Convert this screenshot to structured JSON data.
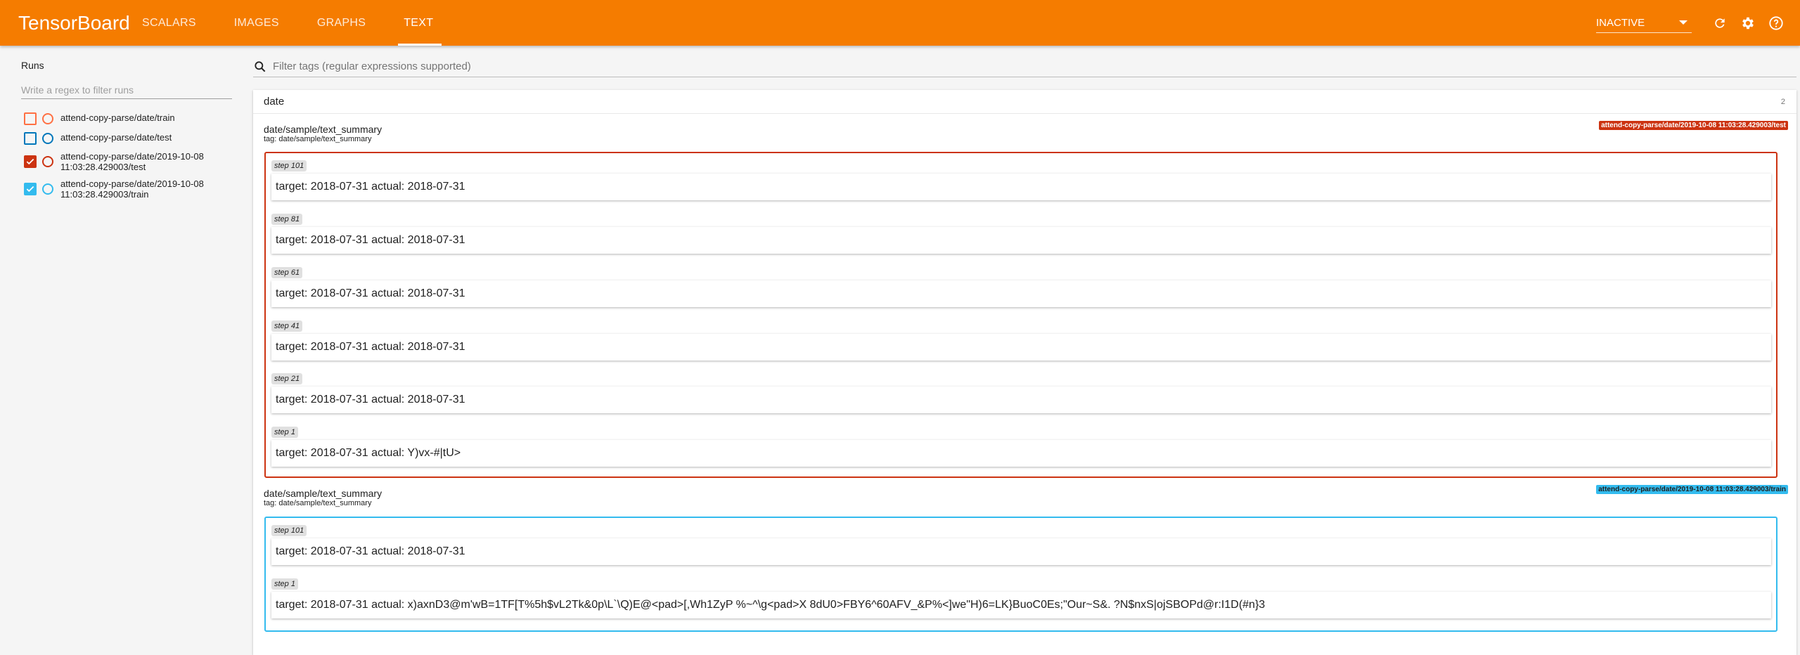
{
  "header": {
    "brand": "TensorBoard",
    "tabs": [
      {
        "label": "SCALARS",
        "active": false
      },
      {
        "label": "IMAGES",
        "active": false
      },
      {
        "label": "GRAPHS",
        "active": false
      },
      {
        "label": "TEXT",
        "active": true
      }
    ],
    "status_select": "INACTIVE",
    "icons": [
      "refresh-icon",
      "settings-icon",
      "help-icon"
    ]
  },
  "sidebar": {
    "title": "Runs",
    "filter_placeholder": "Write a regex to filter runs",
    "runs": [
      {
        "label": "attend-copy-parse/date/train",
        "checked": false,
        "color": "#ff7043"
      },
      {
        "label": "attend-copy-parse/date/test",
        "checked": false,
        "color": "#0077bb"
      },
      {
        "label": "attend-copy-parse/date/2019-10-08 11:03:28.429003/test",
        "checked": true,
        "color": "#cc3311"
      },
      {
        "label": "attend-copy-parse/date/2019-10-08 11:03:28.429003/train",
        "checked": true,
        "color": "#33bbee"
      }
    ]
  },
  "main": {
    "tag_filter_placeholder": "Filter tags (regular expressions supported)",
    "card": {
      "title": "date",
      "count": "2",
      "summaries": [
        {
          "name": "date/sample/text_summary",
          "tag": "tag: date/sample/text_summary",
          "run": "attend-copy-parse/date/2019-10-08 11:03:28.429003/test",
          "color": "#cc3311",
          "steps": [
            {
              "step": "step 101",
              "text": "target: 2018-07-31 actual: 2018-07-31"
            },
            {
              "step": "step 81",
              "text": "target: 2018-07-31 actual: 2018-07-31"
            },
            {
              "step": "step 61",
              "text": "target: 2018-07-31 actual: 2018-07-31"
            },
            {
              "step": "step 41",
              "text": "target: 2018-07-31 actual: 2018-07-31"
            },
            {
              "step": "step 21",
              "text": "target: 2018-07-31 actual: 2018-07-31"
            },
            {
              "step": "step 1",
              "text": "target: 2018-07-31 actual: Y)vx-#|tU>"
            }
          ]
        },
        {
          "name": "date/sample/text_summary",
          "tag": "tag: date/sample/text_summary",
          "run": "attend-copy-parse/date/2019-10-08 11:03:28.429003/train",
          "color": "#33bbee",
          "steps": [
            {
              "step": "step 101",
              "text": "target: 2018-07-31 actual: 2018-07-31"
            },
            {
              "step": "step 1",
              "text": "target: 2018-07-31 actual: x)axnD3@m'wB=1TF[T%5h$vL2Tk&0p\\L`\\Q)E@<pad>[,Wh1ZyP %~^\\g<pad>X 8dU0>FBY6^60AFV_&P%<]we\"H)6=LK}BuoC0Es;\"Our~S&. ?N$nxS|ojSBOPd@r:I1D(#n}3"
            }
          ]
        }
      ]
    }
  }
}
